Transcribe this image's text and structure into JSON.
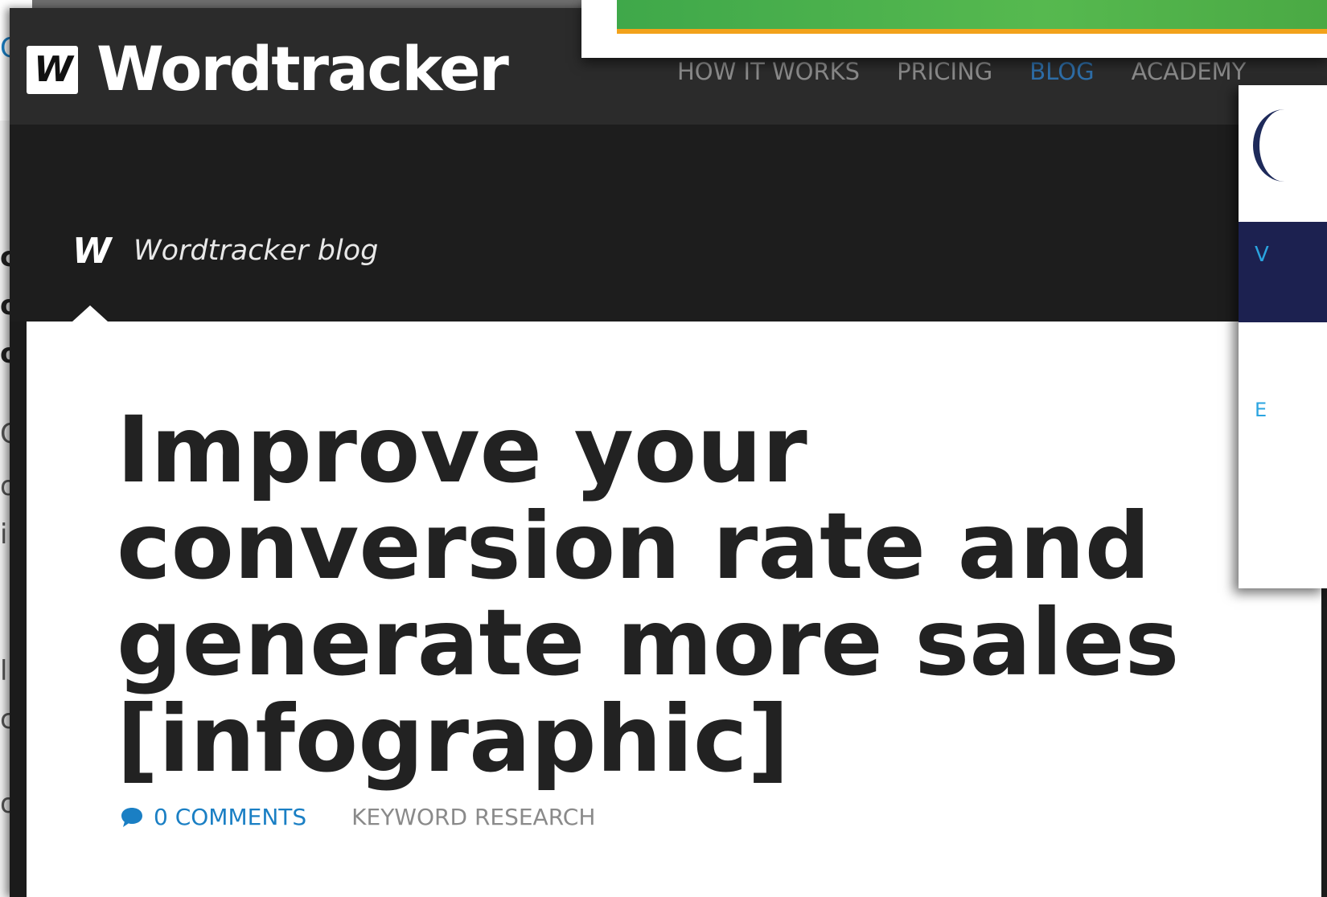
{
  "background_page": {
    "fragments": [
      "C",
      "c",
      "o:",
      "o",
      "C",
      "o",
      "i",
      "l",
      "c,",
      "o"
    ]
  },
  "header": {
    "logo_letter": "W",
    "brand": "Wordtracker",
    "nav": [
      "HOW IT WORKS",
      "PRICING",
      "BLOG",
      "ACADEMY"
    ],
    "active_nav": "BLOG"
  },
  "blog": {
    "logo_letter": "W",
    "title": "Wordtracker blog"
  },
  "article": {
    "title": "Improve your conversion rate and generate more sales [infographic]",
    "comments": "0 COMMENTS",
    "category": "KEYWORD RESEARCH"
  },
  "overlay_right": {
    "navy_letter": "V",
    "blue_letter": "E"
  },
  "colors": {
    "accent_blue": "#1a7fc4",
    "nav_active": "#2e6ea8",
    "banner_green": "#4aa944",
    "banner_orange": "#f2a21b",
    "navy": "#1c2150"
  }
}
